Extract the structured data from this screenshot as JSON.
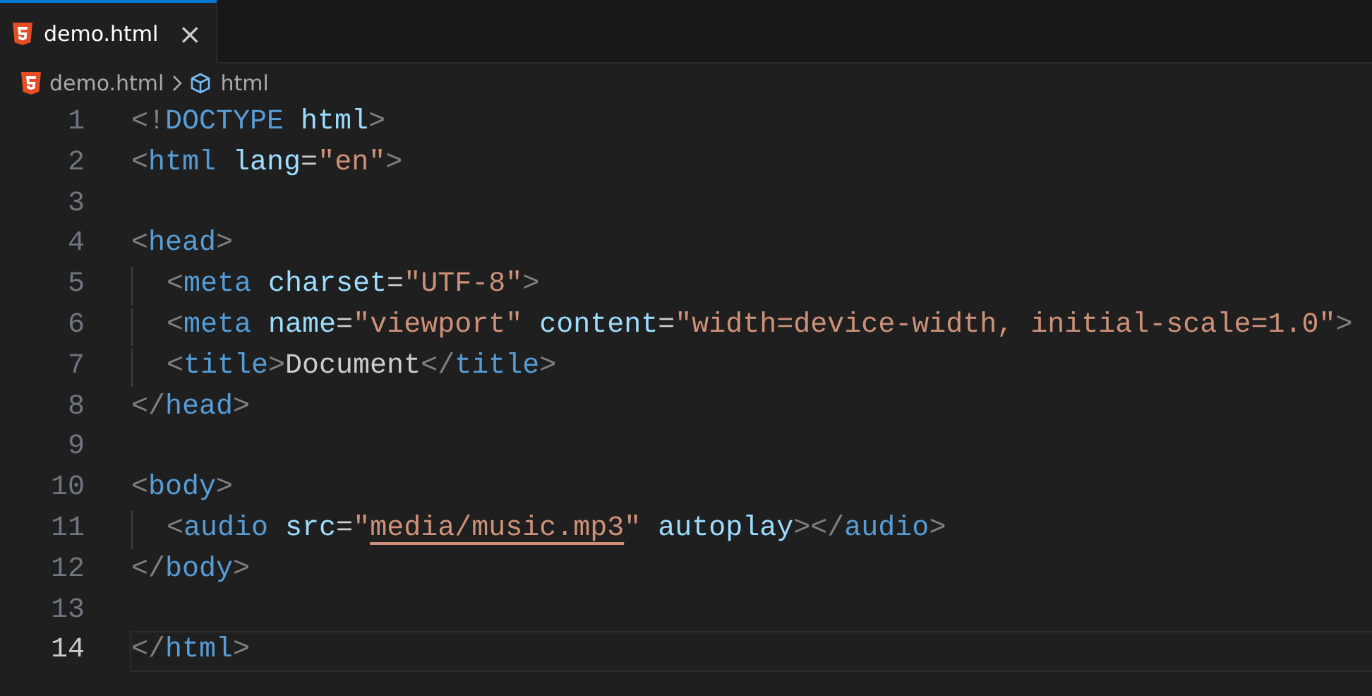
{
  "tabs": [
    {
      "label": "demo.html",
      "selected": true,
      "close": "×"
    }
  ],
  "breadcrumb": [
    {
      "kind": "file",
      "label": "demo.html"
    },
    {
      "kind": "symbol",
      "label": "html"
    }
  ],
  "lines": [
    {
      "number": "1",
      "current": false,
      "tokens": [
        {
          "kind": "punct",
          "text": "<!"
        },
        {
          "kind": "tag",
          "text": "DOCTYPE"
        },
        {
          "kind": "attr",
          "text": " html"
        },
        {
          "kind": "punct",
          "text": ">"
        }
      ]
    },
    {
      "number": "2",
      "current": false,
      "tokens": [
        {
          "kind": "punct",
          "text": "<"
        },
        {
          "kind": "tag",
          "text": "html"
        },
        {
          "kind": "attr",
          "text": " lang"
        },
        {
          "kind": "text",
          "text": "="
        },
        {
          "kind": "string",
          "text": "\"en\""
        },
        {
          "kind": "punct",
          "text": ">"
        }
      ]
    },
    {
      "number": "3",
      "current": false
    },
    {
      "number": "4",
      "current": false,
      "tokens": [
        {
          "kind": "punct",
          "text": "<"
        },
        {
          "kind": "tag",
          "text": "head"
        },
        {
          "kind": "punct",
          "text": ">"
        }
      ],
      "children": [
        {
          "number": "5",
          "current": false,
          "tokens": [
            {
              "kind": "punct",
              "text": "<"
            },
            {
              "kind": "tag",
              "text": "meta"
            },
            {
              "kind": "attr",
              "text": " charset"
            },
            {
              "kind": "text",
              "text": "="
            },
            {
              "kind": "string",
              "text": "\"UTF-8\""
            },
            {
              "kind": "punct",
              "text": ">"
            }
          ]
        },
        {
          "number": "6",
          "current": false,
          "tokens": [
            {
              "kind": "punct",
              "text": "<"
            },
            {
              "kind": "tag",
              "text": "meta"
            },
            {
              "kind": "attr",
              "text": " name"
            },
            {
              "kind": "text",
              "text": "="
            },
            {
              "kind": "string",
              "text": "\"viewport\""
            },
            {
              "kind": "attr",
              "text": " content"
            },
            {
              "kind": "text",
              "text": "="
            },
            {
              "kind": "string",
              "text": "\"width=device-width, initial-scale=1.0\""
            },
            {
              "kind": "punct",
              "text": ">"
            }
          ]
        },
        {
          "number": "7",
          "current": false,
          "tokens": [
            {
              "kind": "punct",
              "text": "<"
            },
            {
              "kind": "tag",
              "text": "title"
            },
            {
              "kind": "punct",
              "text": ">"
            },
            {
              "kind": "text",
              "text": "Document"
            },
            {
              "kind": "punct",
              "text": "</"
            },
            {
              "kind": "tag",
              "text": "title"
            },
            {
              "kind": "punct",
              "text": ">"
            }
          ]
        }
      ]
    },
    {
      "number": "8",
      "current": false,
      "tokens": [
        {
          "kind": "punct",
          "text": "</"
        },
        {
          "kind": "tag",
          "text": "head"
        },
        {
          "kind": "punct",
          "text": ">"
        }
      ]
    },
    {
      "number": "9",
      "current": false
    },
    {
      "number": "10",
      "current": false,
      "tokens": [
        {
          "kind": "punct",
          "text": "<"
        },
        {
          "kind": "tag",
          "text": "body"
        },
        {
          "kind": "punct",
          "text": ">"
        }
      ],
      "children": [
        {
          "number": "11",
          "current": false,
          "tokens": [
            {
              "kind": "punct",
              "text": "<"
            },
            {
              "kind": "tag",
              "text": "audio"
            },
            {
              "kind": "attr",
              "text": " src"
            },
            {
              "kind": "text",
              "text": "="
            },
            {
              "kind": "string",
              "text": "\""
            },
            {
              "kind": "link",
              "text": "media/music.mp3"
            },
            {
              "kind": "string",
              "text": "\""
            },
            {
              "kind": "attr",
              "text": " autoplay"
            },
            {
              "kind": "punct",
              "text": "></"
            },
            {
              "kind": "tag",
              "text": "audio"
            },
            {
              "kind": "punct",
              "text": ">"
            }
          ]
        }
      ]
    },
    {
      "number": "12",
      "current": false,
      "tokens": [
        {
          "kind": "punct",
          "text": "</"
        },
        {
          "kind": "tag",
          "text": "body"
        },
        {
          "kind": "punct",
          "text": ">"
        }
      ]
    },
    {
      "number": "13",
      "current": false
    },
    {
      "number": "14",
      "current": true,
      "tokens": [
        {
          "kind": "punct",
          "text": "</"
        },
        {
          "kind": "tag",
          "text": "html"
        },
        {
          "kind": "punct",
          "text": ">"
        }
      ]
    }
  ]
}
